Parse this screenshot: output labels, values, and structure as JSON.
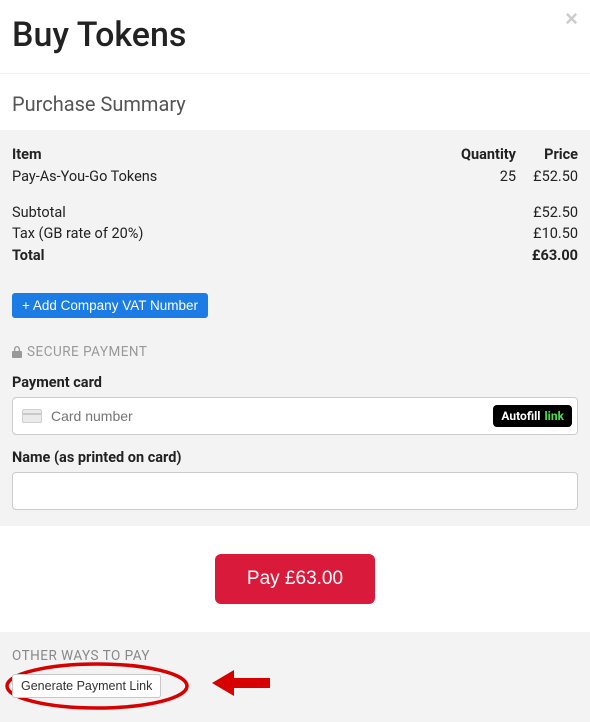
{
  "header": {
    "title": "Buy Tokens",
    "close": "×"
  },
  "summary": {
    "title": "Purchase Summary",
    "columns": {
      "item": "Item",
      "qty": "Quantity",
      "price": "Price"
    },
    "line_item": {
      "name": "Pay-As-You-Go Tokens",
      "qty": "25",
      "price": "£52.50"
    },
    "subtotal": {
      "label": "Subtotal",
      "value": "£52.50"
    },
    "tax": {
      "label": "Tax (GB rate of 20%)",
      "value": "£10.50"
    },
    "total": {
      "label": "Total",
      "value": "£63.00"
    },
    "vat_button": "+ Add Company VAT Number"
  },
  "payment": {
    "secure_label": "SECURE PAYMENT",
    "card_label": "Payment card",
    "card_placeholder": "Card number",
    "autofill_a": "Autofill",
    "autofill_b": "link",
    "name_label": "Name (as printed on card)"
  },
  "pay_button": "Pay £63.00",
  "other": {
    "title": "OTHER WAYS TO PAY",
    "generate_link": "Generate Payment Link"
  }
}
